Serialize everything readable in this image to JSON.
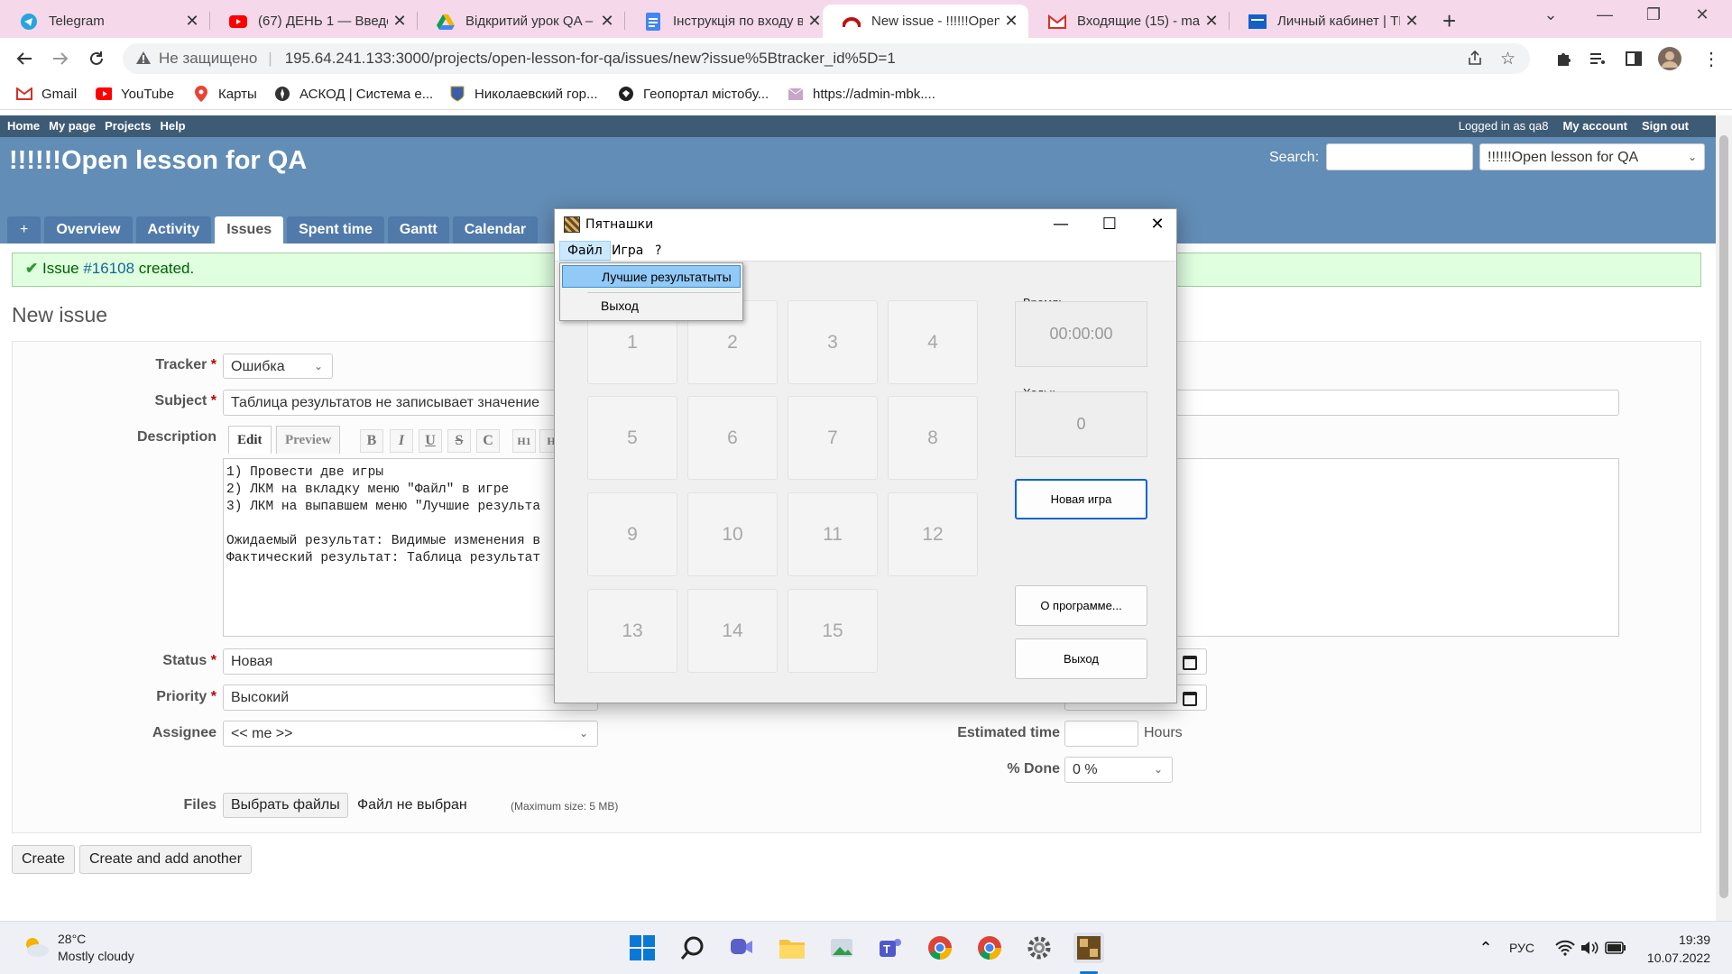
{
  "browser": {
    "tabs": [
      {
        "title": "Telegram",
        "icon": "telegram-icon",
        "color": "#2aa3df"
      },
      {
        "title": "(67) ДЕНЬ 1 — Введе",
        "icon": "youtube-icon",
        "color": "#ff0000"
      },
      {
        "title": "Відкритий урок QA –",
        "icon": "google-drive-icon",
        "color": "#f4b400"
      },
      {
        "title": "Інструкція по входу в",
        "icon": "google-docs-icon",
        "color": "#4285f4"
      },
      {
        "title": "New issue - !!!!!!Open",
        "icon": "redmine-icon",
        "color": "#c01010"
      },
      {
        "title": "Входящие (15) - mat",
        "icon": "gmail-icon",
        "color": "#d93025"
      },
      {
        "title": "Личный кабинет | TE",
        "icon": "site-icon",
        "color": "#1460c8"
      }
    ],
    "insecure_label": "Не защищено",
    "url": "195.64.241.133:3000/projects/open-lesson-for-qa/issues/new?issue%5Btracker_id%5D=1",
    "bookmarks": [
      {
        "label": "Gmail",
        "icon": "gmail-icon"
      },
      {
        "label": "YouTube",
        "icon": "youtube-icon"
      },
      {
        "label": "Карты",
        "icon": "maps-icon"
      },
      {
        "label": "АСКОД | Система е...",
        "icon": "askod-icon"
      },
      {
        "label": "Николаевский гор...",
        "icon": "city-crest-icon"
      },
      {
        "label": "Геопортал містобу...",
        "icon": "geoportal-icon"
      },
      {
        "label": "https://admin-mbk....",
        "icon": "admin-site-icon"
      }
    ]
  },
  "redmine": {
    "top_left": [
      "Home",
      "My page",
      "Projects",
      "Help"
    ],
    "logged_in_as": "Logged in as qa8",
    "my_account": "My account",
    "sign_out": "Sign out",
    "project_title": "!!!!!!Open lesson for QA",
    "search_label": "Search:",
    "project_select": "!!!!!!Open lesson for QA",
    "menu": [
      "+",
      "Overview",
      "Activity",
      "Issues",
      "Spent time",
      "Gantt",
      "Calendar"
    ],
    "flash_prefix": "Issue ",
    "flash_link": "#16108",
    "flash_suffix": " created.",
    "heading": "New issue",
    "form": {
      "tracker_label": "Tracker",
      "tracker_value": "Ошибка",
      "subject_label": "Subject",
      "subject_value": "Таблица результатов не записывает значение",
      "description_label": "Description",
      "edit_tab": "Edit",
      "preview_tab": "Preview",
      "toolbar": [
        "B",
        "I",
        "U",
        "S",
        "C",
        "H1",
        "H"
      ],
      "description_text": "1) Провести две игры\n2) ЛКМ на вкладку меню \"Файл\" в игре\n3) ЛКМ на выпавшем меню \"Лучшие результа\n\nОжидаемый результат: Видимые изменения в\nФактический результат: Таблица результат",
      "status_label": "Status",
      "status_value": "Новая",
      "priority_label": "Priority",
      "priority_value": "Высокий",
      "assignee_label": "Assignee",
      "assignee_value": "<< me >>",
      "estimated_label": "Estimated time",
      "hours": "Hours",
      "done_label": "% Done",
      "done_value": "0 %",
      "files_label": "Files",
      "choose_files": "Выбрать файлы",
      "no_file": "Файл не выбран",
      "max_size": "(Maximum size: 5 MB)"
    },
    "create": "Create",
    "create_another": "Create and add another"
  },
  "game": {
    "title": "Пятнашки",
    "menu": [
      "Файл",
      "Игра",
      "?"
    ],
    "dropdown": [
      "Лучшие результатыты",
      "Выход"
    ],
    "tiles": [
      "1",
      "2",
      "3",
      "4",
      "5",
      "6",
      "7",
      "8",
      "9",
      "10",
      "11",
      "12",
      "13",
      "14",
      "15"
    ],
    "time_label": "Время:",
    "time_value": "00:00:00",
    "moves_label": "Ходы:",
    "moves_value": "0",
    "new_game": "Новая игра",
    "about": "О программе...",
    "exit": "Выход"
  },
  "taskbar": {
    "temperature": "28°C",
    "weather": "Mostly cloudy",
    "lang": "РУС",
    "time": "19:39",
    "date": "10.07.2022"
  }
}
